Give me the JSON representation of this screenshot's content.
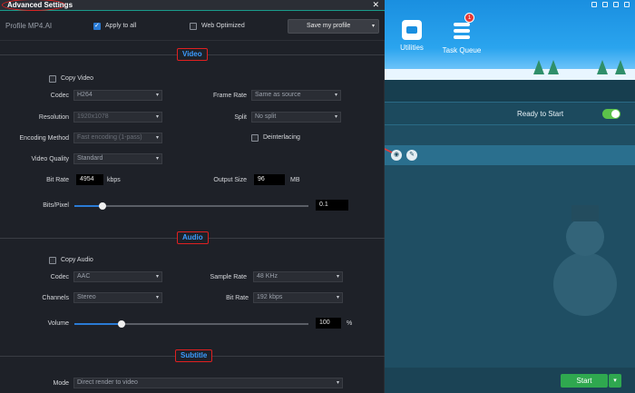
{
  "background_app": {
    "tools": [
      {
        "label": "Utilities"
      },
      {
        "label": "Task Queue",
        "badge": "1"
      }
    ],
    "status": "Ready to Start",
    "start_label": "Start",
    "start_dropdown": "▾",
    "toggle_on": true
  },
  "dialog": {
    "title": "Advanced Settings",
    "close": "✕",
    "profile": "Profile  MP4.AI",
    "apply_to_all": {
      "label": "Apply to all",
      "checked": true
    },
    "web_optimized": {
      "label": "Web Optimized",
      "checked": false
    },
    "save_profile": {
      "label": "Save my profile",
      "caret": "▾"
    }
  },
  "video": {
    "section": "Video",
    "copy_video": {
      "label": "Copy Video",
      "checked": false
    },
    "codec": {
      "label": "Codec",
      "value": "H264"
    },
    "frame_rate": {
      "label": "Frame Rate",
      "value": "Same as source"
    },
    "resolution": {
      "label": "Resolution",
      "value": "1920x1078"
    },
    "split": {
      "label": "Split",
      "value": "No split"
    },
    "encoding_method": {
      "label": "Encoding Method",
      "value": "Fast encoding (1-pass)"
    },
    "deinterlacing": {
      "label": "Deinterlacing",
      "checked": false
    },
    "video_quality": {
      "label": "Video Quality",
      "value": "Standard"
    },
    "bit_rate": {
      "label": "Bit Rate",
      "value": "4954",
      "unit": "kbps"
    },
    "output_size": {
      "label": "Output Size",
      "value": "96",
      "unit": "MB"
    },
    "bits_pixel": {
      "label": "Bits/Pixel",
      "value": "0.1",
      "level": 0.12
    }
  },
  "audio": {
    "section": "Audio",
    "copy_audio": {
      "label": "Copy Audio",
      "checked": false
    },
    "codec": {
      "label": "Codec",
      "value": "AAC"
    },
    "sample_rate": {
      "label": "Sample Rate",
      "value": "48 KHz"
    },
    "channels": {
      "label": "Channels",
      "value": "Stereo"
    },
    "bit_rate": {
      "label": "Bit Rate",
      "value": "192 kbps"
    },
    "volume": {
      "label": "Volume",
      "value": "100",
      "unit": "%",
      "level": 0.2
    }
  },
  "subtitle": {
    "section": "Subtitle",
    "mode": {
      "label": "Mode",
      "value": "Direct render to video"
    }
  },
  "icons": {
    "caret": "▾"
  }
}
